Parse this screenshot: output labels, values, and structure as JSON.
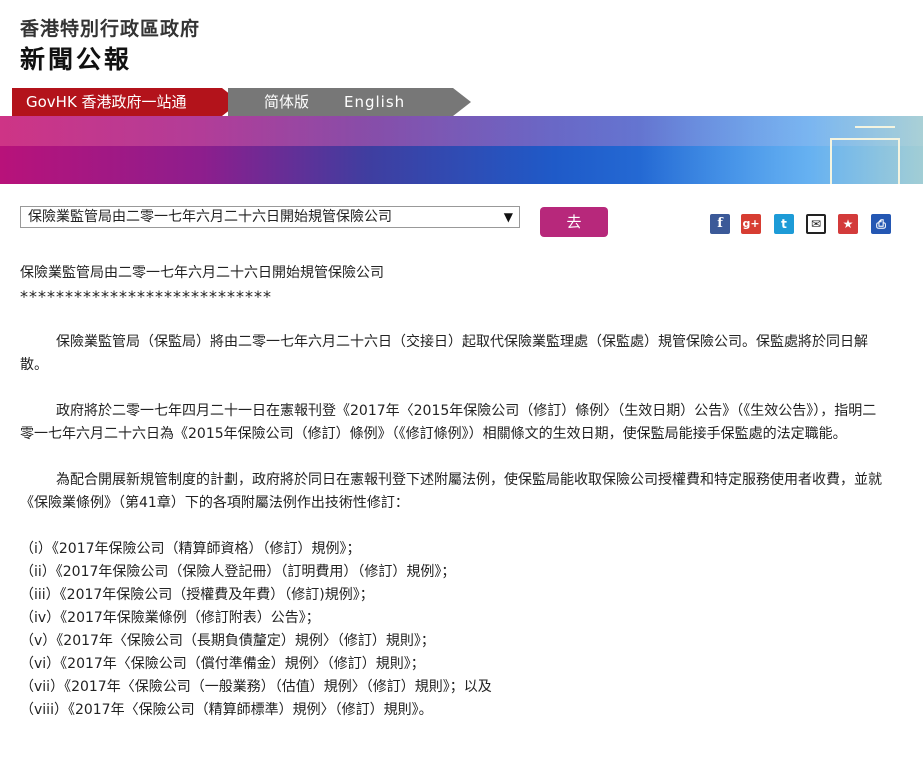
{
  "header": {
    "gov_name": "香港特別行政區政府",
    "press_title": "新聞公報"
  },
  "nav": {
    "govhk": "GovHK 香港政府一站通",
    "simplified": "简体版",
    "english": "English"
  },
  "colors": {
    "nav_red": "#b3131b",
    "nav_gray": "#777777",
    "go_button": "#b7287b"
  },
  "selector": {
    "selected": "保險業監管局由二零一七年六月二十六日開始規管保險公司",
    "go_label": "去"
  },
  "share_icons": [
    "facebook-icon",
    "google-plus-icon",
    "twitter-icon",
    "email-icon",
    "bookmark-icon",
    "print-icon"
  ],
  "article": {
    "title": "保險業監管局由二零一七年六月二十六日開始規管保險公司",
    "stars": "****************************",
    "paragraphs": [
      "保險業監管局（保監局）將由二零一七年六月二十六日（交接日）起取代保險業監理處（保監處）規管保險公司。保監處將於同日解散。",
      "政府將於二零一七年四月二十一日在憲報刊登《2017年〈2015年保險公司（修訂）條例〉（生效日期）公告》（《生效公告》），指明二零一七年六月二十六日為《2015年保險公司（修訂）條例》（《修訂條例》）相關條文的生效日期，使保監局能接手保監處的法定職能。",
      "為配合開展新規管制度的計劃，政府將於同日在憲報刊登下述附屬法例，使保監局能收取保險公司授權費和特定服務使用者收費，並就《保險業條例》（第41章）下的各項附屬法例作出技術性修訂："
    ],
    "items": [
      "（i）《2017年保險公司（精算師資格）（修訂）規例》；",
      "（ii）《2017年保險公司（保險人登記冊）（訂明費用）（修訂）規例》；",
      "（iii）《2017年保險公司（授權費及年費）（修訂)規例》；",
      "（iv）《2017年保險業條例（修訂附表）公告》；",
      "（v）《2017年〈保險公司（長期負債釐定）規例〉（修訂）規則》；",
      "（vi）《2017年〈保險公司（償付準備金）規例〉（修訂）規則》；",
      "（vii）《2017年〈保險公司（一般業務）（估值）規例〉（修訂）規則》；以及",
      "（viii）《2017年〈保險公司（精算師標準）規例〉（修訂）規則》。"
    ]
  }
}
